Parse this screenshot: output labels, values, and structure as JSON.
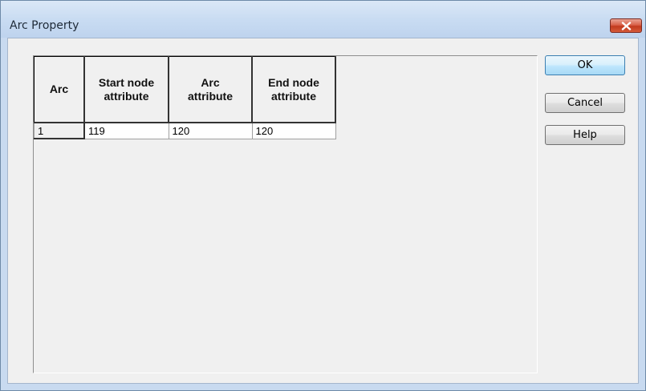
{
  "window": {
    "title": "Arc Property"
  },
  "icons": {
    "close": "close-icon"
  },
  "table": {
    "headers": [
      {
        "line1": "Arc",
        "line2": ""
      },
      {
        "line1": "Start node",
        "line2": "attribute"
      },
      {
        "line1": "Arc",
        "line2": "attribute"
      },
      {
        "line1": "End node",
        "line2": "attribute"
      }
    ],
    "rows": [
      {
        "cells": [
          "1",
          "119",
          "120",
          "120"
        ]
      }
    ]
  },
  "buttons": {
    "ok": "OK",
    "cancel": "Cancel",
    "help": "Help"
  },
  "colors": {
    "close_button": "#c23a1e",
    "dialog_background": "#f0f0f0",
    "default_button_border": "#3c7fb1"
  }
}
